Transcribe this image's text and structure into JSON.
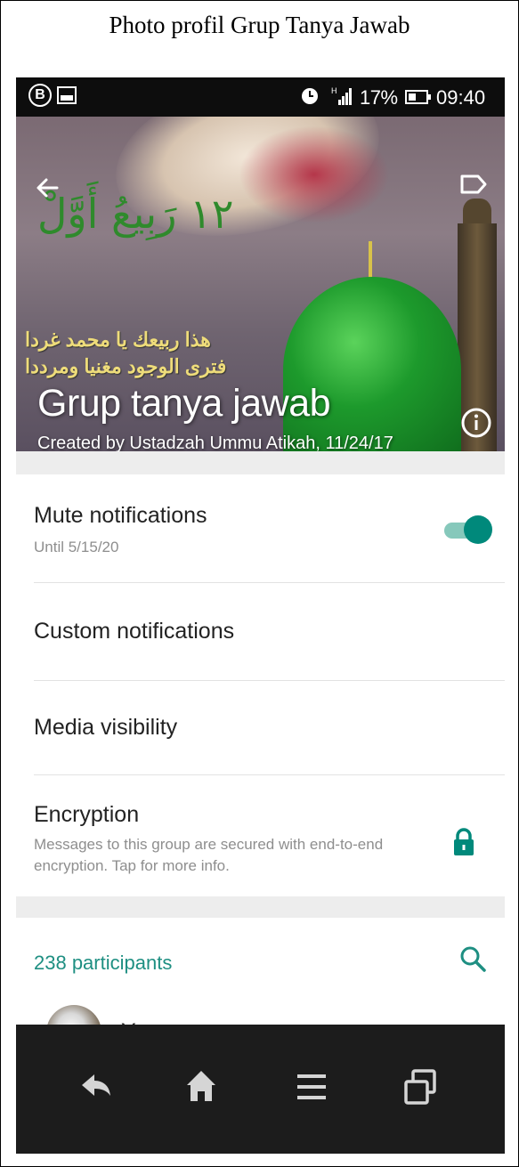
{
  "caption": "Photo profil Grup Tanya Jawab",
  "status_bar": {
    "left_badge": "B",
    "signal_label": "H",
    "battery_percent": "17%",
    "time": "09:40",
    "icons": [
      "b-circle-icon",
      "image-notification-icon",
      "alarm-clock-icon",
      "signal-icon",
      "battery-icon"
    ]
  },
  "header": {
    "arabic_title": "١٢ رَبِيعُ أَوَّلْ",
    "poem_line_1": "هذا ربيعك يا محمد غردا",
    "poem_line_2": "فترى الوجود مغنيا ومرددا",
    "group_name": "Grup tanya jawab",
    "created_info": "Created by Ustadzah Ummu Atikah, 11/24/17",
    "icons": [
      "back-arrow-icon",
      "label-tag-icon",
      "info-icon"
    ]
  },
  "settings": {
    "mute": {
      "title": "Mute notifications",
      "subtitle": "Until 5/15/20",
      "enabled": true
    },
    "custom": {
      "title": "Custom notifications"
    },
    "media": {
      "title": "Media visibility"
    },
    "encryption": {
      "title": "Encryption",
      "description_line1": "Messages to this group are secured with end-to-end",
      "description_line2": "encryption. Tap for more info."
    }
  },
  "participants": {
    "header": "238 participants",
    "items": [
      {
        "name": "You"
      }
    ]
  },
  "nav_bar": {
    "buttons": [
      "back-icon",
      "home-icon",
      "menu-icon",
      "recent-apps-icon"
    ]
  },
  "colors": {
    "accent": "#00897b",
    "participants_text": "#1e8f82",
    "status_bar_bg": "#0d0d0d",
    "nav_bar_bg": "#1c1c1c",
    "section_gap": "#ededed",
    "dome_green": "#1d9a2c"
  }
}
